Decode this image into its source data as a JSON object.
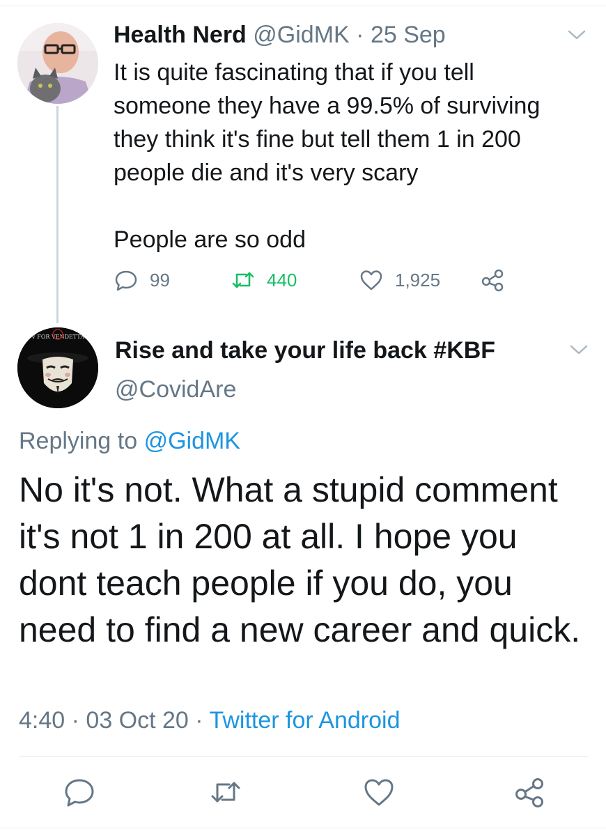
{
  "tweet1": {
    "author_name": "Health Nerd",
    "handle": "@GidMK",
    "separator": "·",
    "date": "25 Sep",
    "text_lines": [
      "It is quite fascinating that if you tell",
      "someone they have a 99.5% of surviving",
      "they think it's fine but tell them 1 in 200",
      "people die and it's very scary"
    ],
    "text_last": "People are so odd",
    "reply_count": "99",
    "retweet_count": "440",
    "like_count": "1,925"
  },
  "tweet2": {
    "author_name": "Rise and take your life back #KBF",
    "handle": "@CovidAre",
    "replying_prefix": "Replying to",
    "replying_handle": "@GidMK",
    "text": "No it's not. What a stupid comment it's not 1 in 200 at all. I hope you dont teach people if you do, you need to find a new career and quick.",
    "time": "4:40",
    "separator": "·",
    "date": "03 Oct 20",
    "separator2": "·",
    "client": "Twitter for Android"
  },
  "avatar2_badge_text": "V FOR VENDETTA",
  "colors": {
    "text": "#14171a",
    "muted": "#657786",
    "link": "#1b95e0",
    "retweet_green": "#17bf63",
    "divider": "#e6ecf0"
  },
  "icons": [
    "reply-icon",
    "retweet-icon",
    "like-icon",
    "share-icon",
    "chevron-down-icon"
  ]
}
